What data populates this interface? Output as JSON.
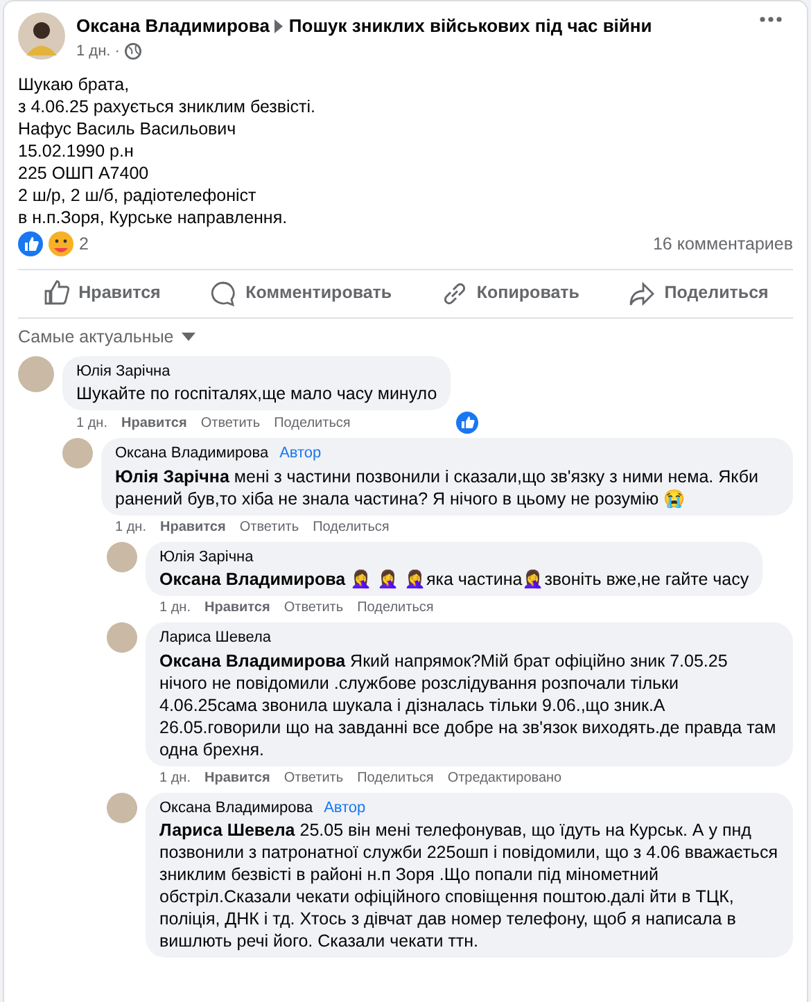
{
  "post": {
    "author": "Оксана Владимирова",
    "group": "Пошук зниклих військових під час війни",
    "time": "1 дн. ·",
    "lines": [
      "Шукаю брата,",
      "з 4.06.25 рахується зниклим безвісті.",
      "Нафус Василь Васильович",
      "15.02.1990 р.н",
      "225 ОШП А7400",
      "2 ш/р, 2 ш/б, радіотелефоніст",
      "в н.п.Зоря, Курське направлення."
    ],
    "reactions_count": "2",
    "comments_count": "16 комментариев"
  },
  "actions": [
    {
      "kind": "like",
      "label": "Нравится"
    },
    {
      "kind": "comment",
      "label": "Комментировать"
    },
    {
      "kind": "copy",
      "label": "Копировать"
    },
    {
      "kind": "share",
      "label": "Поделиться"
    }
  ],
  "sort": {
    "label": "Самые актуальные"
  },
  "comments": [
    {
      "author": "Юлія Зарічна",
      "text": "Шукайте по госпіталях,ще мало часу минуло",
      "time": "1 дн.",
      "like": "Нравится",
      "reply": "Ответить",
      "share": "Поделиться",
      "liked_reaction": true,
      "children": [
        {
          "author": "Оксана Владимирова",
          "badge": "Автор",
          "text": "**Юлія Зарічна** мені з частини позвонили і сказали,що зв'язку з ними нема. Якби ранений був,то хіба не знала частина? Я нічого в цьому не розумію 😭",
          "time": "1 дн.",
          "like": "Нравится",
          "reply": "Ответить",
          "share": "Поделиться",
          "children": [
            {
              "author": "Юлія Зарічна",
              "text": "**Оксана Владимирова** 🤦‍♀️ 🤦‍♀️ 🤦‍♀️яка частина🤦‍♀️звоніть вже,не гайте часу",
              "time": "1 дн.",
              "like": "Нравится",
              "reply": "Ответить",
              "share": "Поделиться"
            },
            {
              "author": "Лариса Шевела",
              "text": "**Оксана Владимирова** Який напрямок?Мій брат офіційно зник 7.05.25 нічого не повідомили .службове розслідування розпочали тільки 4.06.25сама звонила шукала і дізналась тільки 9.06.,що зник.А 26.05.говорили що на завданні все добре на зв'язок виходять.де правда там одна брехня.",
              "time": "1 дн.",
              "like": "Нравится",
              "reply": "Ответить",
              "share": "Поделиться",
              "edited": "Отредактировано"
            },
            {
              "author": "Оксана Владимирова",
              "badge": "Автор",
              "text": "**Лариса Шевела** 25.05 він мені телефонував, що їдуть на Курськ. А у пнд позвонили з патронатної служби 225ошп і повідомили, що з 4.06 вважається зниклим безвісті в районі н.п Зоря .Що попали під мінометний обстріл.Сказали чекати офіційного сповіщення поштою.далі йти в ТЦК, поліція, ДНК і тд. Хтось з дівчат дав номер телефону, щоб я написала в вишлють речі його. Сказали чекати ттн."
            }
          ]
        }
      ]
    }
  ]
}
